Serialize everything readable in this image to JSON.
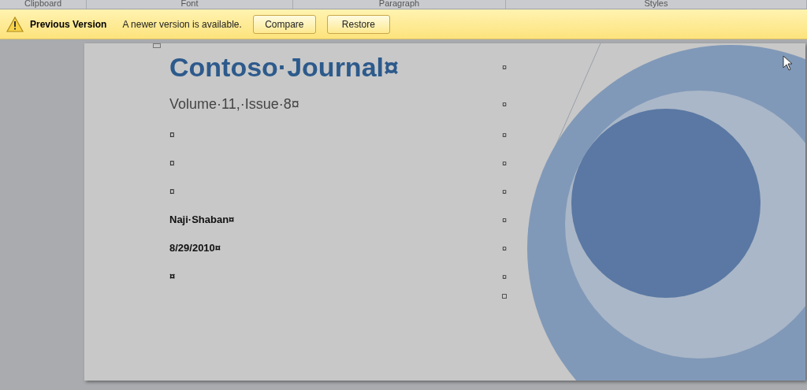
{
  "ribbon_groups": [
    "Clipboard",
    "Font",
    "Paragraph",
    "Styles"
  ],
  "message_bar": {
    "title": "Previous Version",
    "message": "A newer version is available.",
    "buttons": [
      "Compare",
      "Restore"
    ]
  },
  "document": {
    "rows": [
      {
        "kind": "title",
        "text": "Contoso·Journal¤",
        "cell_mark": "¤"
      },
      {
        "kind": "subtitle",
        "text": "Volume·11,·Issue·8¤",
        "cell_mark": "¤"
      },
      {
        "kind": "body",
        "text": "¤",
        "cell_mark": "¤"
      },
      {
        "kind": "body",
        "text": "¤",
        "cell_mark": "¤"
      },
      {
        "kind": "body",
        "text": "¤",
        "cell_mark": "¤"
      },
      {
        "kind": "bold",
        "text": "Naji·Shaban¤",
        "cell_mark": "¤"
      },
      {
        "kind": "bold",
        "text": "8/29/2010¤",
        "cell_mark": "¤"
      },
      {
        "kind": "bold",
        "text": "¤",
        "cell_mark": "¤"
      }
    ]
  }
}
